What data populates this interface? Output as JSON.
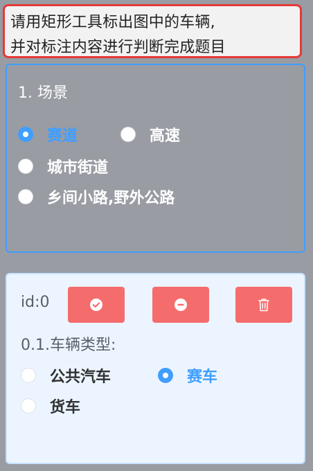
{
  "instruction": {
    "line1": "请用矩形工具标出图中的车辆,",
    "line2": "并对标注内容进行判断完成题目"
  },
  "scene": {
    "title": "1. 场景",
    "options": [
      {
        "label": "赛道",
        "checked": true
      },
      {
        "label": "高速",
        "checked": false
      },
      {
        "label": "城市街道",
        "checked": false
      },
      {
        "label": "乡间小路,野外公路",
        "checked": false
      }
    ]
  },
  "annotation": {
    "id_label": "id:0",
    "buttons": {
      "confirm_icon": "check-circle-icon",
      "remove_icon": "minus-circle-icon",
      "delete_icon": "trash-icon"
    },
    "question_label": "0.1.车辆类型:",
    "options": [
      {
        "label": "公共汽车",
        "checked": false
      },
      {
        "label": "赛车",
        "checked": true
      },
      {
        "label": "货车",
        "checked": false
      }
    ]
  },
  "colors": {
    "accent": "#409eff",
    "danger": "#f56c6c",
    "highlight_border": "#e53935",
    "background": "#999ca3",
    "card_background": "#ecf5ff"
  }
}
